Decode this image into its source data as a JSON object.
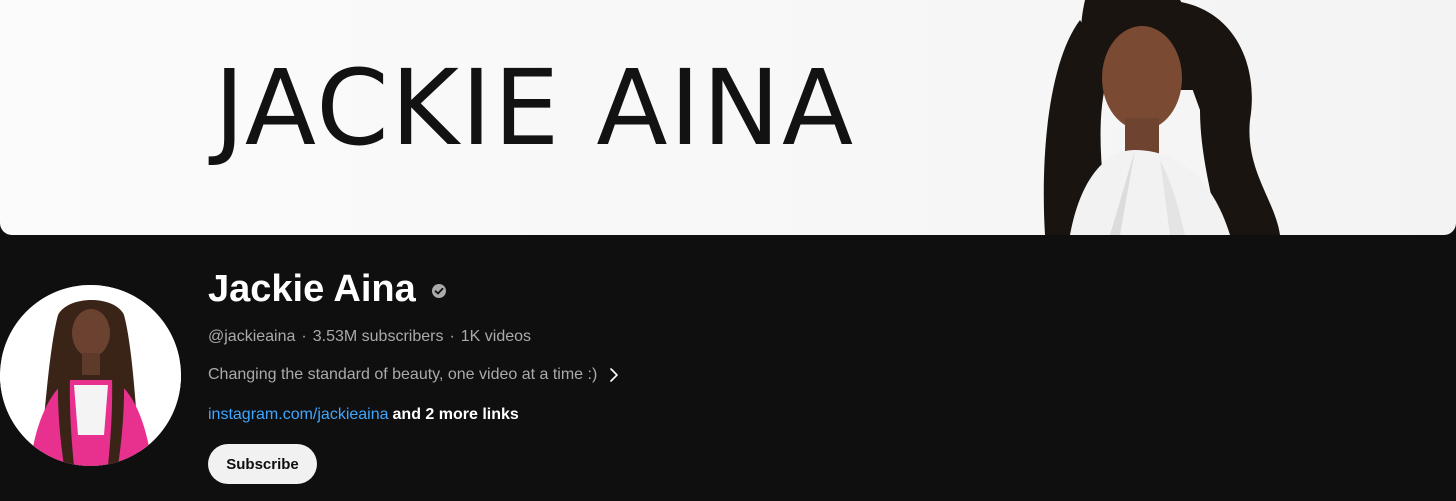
{
  "banner": {
    "title": "JACKIE AINA"
  },
  "channel": {
    "name": "Jackie Aina",
    "verified_icon": "verified-checkmark-icon",
    "handle": "@jackieaina",
    "subscribers": "3.53M subscribers",
    "videos": "1K videos",
    "separator": "·",
    "description": "Changing the standard of beauty, one video at a time :)",
    "description_expand_icon": "chevron-right-icon",
    "link_text": "instagram.com/jackieaina",
    "more_links": "and 2 more links",
    "subscribe_label": "Subscribe"
  },
  "colors": {
    "background": "#0f0f0f",
    "link": "#3ea6ff",
    "button_bg": "#f1f1f1",
    "avatar_jacket": "#e8318f"
  }
}
